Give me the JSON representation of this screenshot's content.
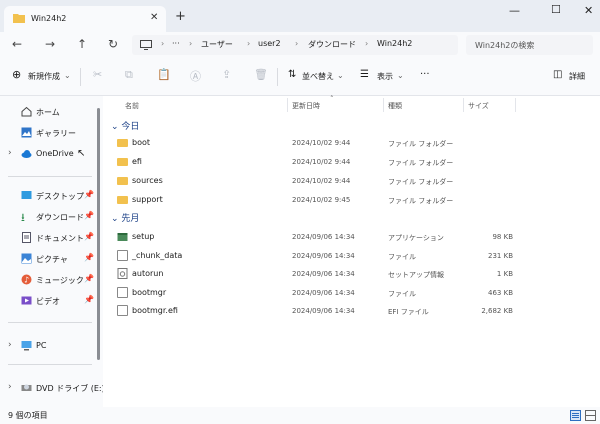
{
  "window": {
    "tab_title": "Win24h2",
    "minimize": "—",
    "maximize": "☐",
    "close": "✕"
  },
  "address": {
    "segments": [
      "ユーザー",
      "user2",
      "ダウンロード",
      "Win24h2"
    ],
    "overflow": "···",
    "search_placeholder": "Win24h2の検索"
  },
  "toolbar": {
    "new_label": "新規作成",
    "sort_label": "並べ替え",
    "view_label": "表示",
    "more_label": "···",
    "details_label": "詳細"
  },
  "nav": {
    "home": "ホーム",
    "gallery": "ギャラリー",
    "onedrive": "OneDrive",
    "quick": [
      "デスクトップ",
      "ダウンロード",
      "ドキュメント",
      "ピクチャ",
      "ミュージック",
      "ビデオ"
    ],
    "pc": "PC",
    "dvd": "DVD ドライブ (E:)"
  },
  "columns": {
    "name": "名前",
    "date": "更新日時",
    "type": "種類",
    "size": "サイズ"
  },
  "groups": {
    "today": "今日",
    "earlier": "先月"
  },
  "files_today": [
    {
      "name": "boot",
      "date": "2024/10/02 9:44",
      "type": "ファイル フォルダー",
      "size": ""
    },
    {
      "name": "efi",
      "date": "2024/10/02 9:44",
      "type": "ファイル フォルダー",
      "size": ""
    },
    {
      "name": "sources",
      "date": "2024/10/02 9:44",
      "type": "ファイル フォルダー",
      "size": ""
    },
    {
      "name": "support",
      "date": "2024/10/02 9:45",
      "type": "ファイル フォルダー",
      "size": ""
    }
  ],
  "files_earlier": [
    {
      "name": "setup",
      "date": "2024/09/06 14:34",
      "type": "アプリケーション",
      "size": "98 KB"
    },
    {
      "name": "_chunk_data",
      "date": "2024/09/06 14:34",
      "type": "ファイル",
      "size": "231 KB"
    },
    {
      "name": "autorun",
      "date": "2024/09/06 14:34",
      "type": "セットアップ情報",
      "size": "1 KB"
    },
    {
      "name": "bootmgr",
      "date": "2024/09/06 14:34",
      "type": "ファイル",
      "size": "463 KB"
    },
    {
      "name": "bootmgr.efi",
      "date": "2024/09/06 14:34",
      "type": "EFI ファイル",
      "size": "2,682 KB"
    }
  ],
  "status": {
    "item_count": "9 個の項目"
  }
}
